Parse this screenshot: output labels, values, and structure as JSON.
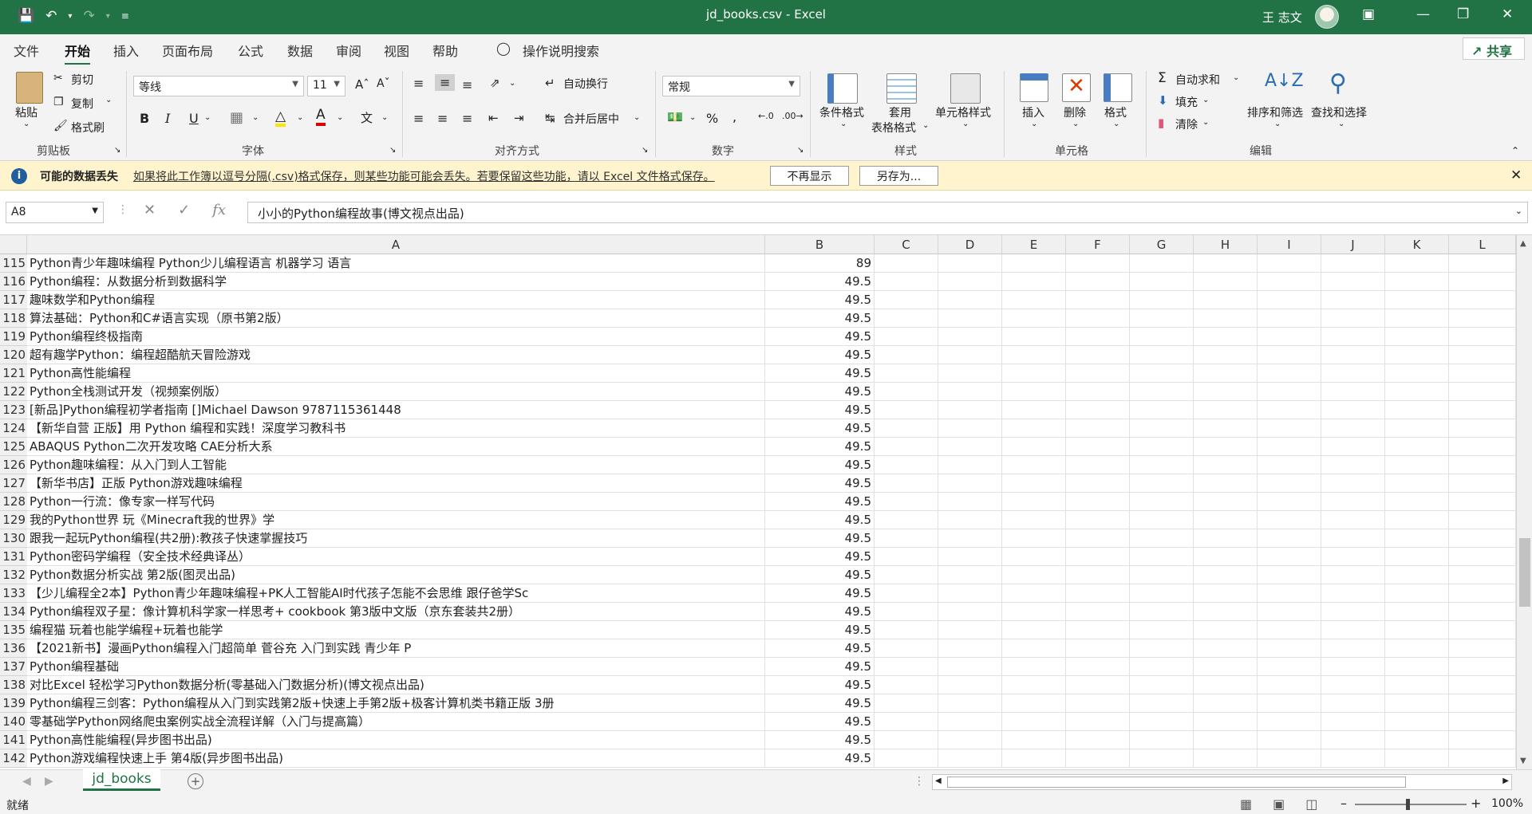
{
  "titlebar": {
    "title": "jd_books.csv  -  Excel",
    "user": "王 志文"
  },
  "menu": {
    "tabs": [
      "文件",
      "开始",
      "插入",
      "页面布局",
      "公式",
      "数据",
      "审阅",
      "视图",
      "帮助"
    ],
    "search": "操作说明搜索",
    "share": "共享"
  },
  "ribbon": {
    "clipboard": {
      "paste": "粘贴",
      "cut": "剪切",
      "copy": "复制",
      "format_painter": "格式刷",
      "label": "剪贴板"
    },
    "font": {
      "name": "等线",
      "size": "11",
      "label": "字体"
    },
    "alignment": {
      "wrap": "自动换行",
      "merge": "合并后居中",
      "label": "对齐方式"
    },
    "number": {
      "format": "常规",
      "label": "数字"
    },
    "styles": {
      "conditional": "条件格式",
      "table1": "套用",
      "table2": "表格格式",
      "cell_styles": "单元格样式",
      "label": "样式"
    },
    "cells": {
      "insert": "插入",
      "delete": "删除",
      "format": "格式",
      "label": "单元格"
    },
    "editing": {
      "autosum": "自动求和",
      "fill": "填充",
      "clear": "清除",
      "sort": "排序和筛选",
      "find": "查找和选择",
      "label": "编辑"
    }
  },
  "message": {
    "title": "可能的数据丢失",
    "text": "如果将此工作簿以逗号分隔(.csv)格式保存，则某些功能可能会丢失。若要保留这些功能，请以 Excel 文件格式保存。",
    "dont_show": "不再显示",
    "save_as": "另存为..."
  },
  "formula_bar": {
    "name_box": "A8",
    "formula": "小小的Python编程故事(博文视点出品)"
  },
  "columns": [
    "A",
    "B",
    "C",
    "D",
    "E",
    "F",
    "G",
    "H",
    "I",
    "J",
    "K",
    "L"
  ],
  "rows": [
    {
      "n": "115",
      "a": "Python青少年趣味编程 Python少儿编程语言 机器学习 语言",
      "b": "89"
    },
    {
      "n": "116",
      "a": "Python编程：从数据分析到数据科学",
      "b": "49.5"
    },
    {
      "n": "117",
      "a": "趣味数学和Python编程",
      "b": "49.5"
    },
    {
      "n": "118",
      "a": "算法基础：Python和C#语言实现（原书第2版）",
      "b": "49.5"
    },
    {
      "n": "119",
      "a": "Python编程终极指南",
      "b": "49.5"
    },
    {
      "n": "120",
      "a": "超有趣学Python：编程超酷航天冒险游戏",
      "b": "49.5"
    },
    {
      "n": "121",
      "a": "Python高性能编程",
      "b": "49.5"
    },
    {
      "n": "122",
      "a": "Python全栈测试开发（视频案例版）",
      "b": "49.5"
    },
    {
      "n": "123",
      "a": "[新品]Python编程初学者指南 []Michael Dawson 9787115361448",
      "b": "49.5"
    },
    {
      "n": "124",
      "a": "【新华自营 正版】用 Python 编程和实践！深度学习教科书",
      "b": "49.5"
    },
    {
      "n": "125",
      "a": "ABAQUS Python二次开发攻略 CAE分析大系",
      "b": "49.5"
    },
    {
      "n": "126",
      "a": "Python趣味编程：从入门到人工智能",
      "b": "49.5"
    },
    {
      "n": "127",
      "a": "【新华书店】正版 Python游戏趣味编程",
      "b": "49.5"
    },
    {
      "n": "128",
      "a": "Python一行流：像专家一样写代码",
      "b": "49.5"
    },
    {
      "n": "129",
      "a": "我的Python世界 玩《Minecraft我的世界》学",
      "b": "49.5"
    },
    {
      "n": "130",
      "a": "跟我一起玩Python编程(共2册):教孩子快速掌握技巧",
      "b": "49.5"
    },
    {
      "n": "131",
      "a": "Python密码学编程（安全技术经典译丛）",
      "b": "49.5"
    },
    {
      "n": "132",
      "a": "Python数据分析实战 第2版(图灵出品)",
      "b": "49.5"
    },
    {
      "n": "133",
      "a": "【少儿编程全2本】Python青少年趣味编程+PK人工智能AI时代孩子怎能不会思维 跟仔爸学Sc",
      "b": "49.5"
    },
    {
      "n": "134",
      "a": "Python编程双子星：像计算机科学家一样思考+ cookbook 第3版中文版（京东套装共2册）",
      "b": "49.5"
    },
    {
      "n": "135",
      "a": "编程猫 玩着也能学编程+玩着也能学",
      "b": "49.5"
    },
    {
      "n": "136",
      "a": "【2021新书】漫画Python编程入门超简单 菅谷充 入门到实践 青少年 P",
      "b": "49.5"
    },
    {
      "n": "137",
      "a": "Python编程基础",
      "b": "49.5"
    },
    {
      "n": "138",
      "a": "对比Excel 轻松学习Python数据分析(零基础入门数据分析)(博文视点出品)",
      "b": "49.5"
    },
    {
      "n": "139",
      "a": "Python编程三剑客：Python编程从入门到实践第2版+快速上手第2版+极客计算机类书籍正版 3册",
      "b": "49.5"
    },
    {
      "n": "140",
      "a": "零基础学Python网络爬虫案例实战全流程详解（入门与提高篇）",
      "b": "49.5"
    },
    {
      "n": "141",
      "a": "Python高性能编程(异步图书出品)",
      "b": "49.5"
    },
    {
      "n": "142",
      "a": "Python游戏编程快速上手 第4版(异步图书出品)",
      "b": "49.5"
    }
  ],
  "sheet_tab": "jd_books",
  "status": {
    "ready": "就绪",
    "zoom": "100%"
  }
}
